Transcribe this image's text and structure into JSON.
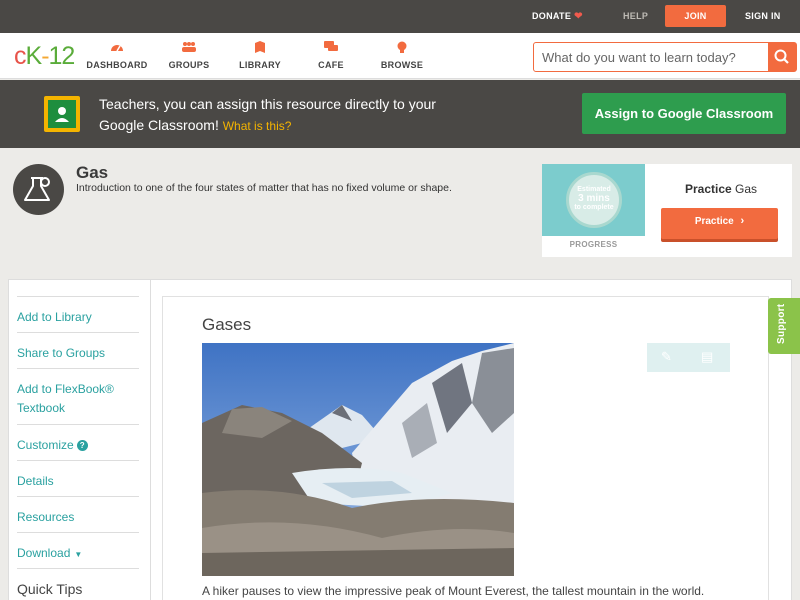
{
  "topbar": {
    "donate": "DONATE",
    "help": "HELP",
    "join": "JOIN",
    "signin": "SIGN IN"
  },
  "nav": {
    "logo": {
      "c": "c",
      "k": "K",
      "dash": "-",
      "n": "12"
    },
    "items": [
      {
        "label": "DASHBOARD",
        "icon": "dashboard-icon"
      },
      {
        "label": "GROUPS",
        "icon": "groups-icon"
      },
      {
        "label": "LIBRARY",
        "icon": "library-icon"
      },
      {
        "label": "CAFE",
        "icon": "cafe-icon"
      },
      {
        "label": "BROWSE",
        "icon": "browse-icon"
      }
    ],
    "search_placeholder": "What do you want to learn today?"
  },
  "banner": {
    "text": "Teachers, you can assign this resource directly to your Google Classroom!",
    "what_link": "What is this?",
    "assign_button": "Assign to Google Classroom"
  },
  "concept": {
    "title": "Gas",
    "description": "Introduction to one of the four states of matter that has no fixed volume or shape."
  },
  "practice": {
    "estimated": "Estimated",
    "mins": "3 mins",
    "to_complete": "to complete",
    "progress_label": "PROGRESS",
    "title_bold": "Practice",
    "title_rest": "Gas",
    "button": "Practice"
  },
  "sidebar": {
    "items": [
      "Add to Library",
      "Share to Groups",
      "Add to FlexBook® Textbook",
      "Customize",
      "Details",
      "Resources",
      "Download"
    ],
    "quick_tips": "Quick Tips"
  },
  "content": {
    "title": "Gases",
    "caption": "A hiker pauses to view the impressive peak of Mount Everest, the tallest mountain in the world."
  },
  "support": "Support",
  "colors": {
    "brand_orange": "#f26b3f",
    "dark_bar": "#4a4845",
    "google_green": "#2e9d4e",
    "link_teal": "#2aa1a0",
    "support_green": "#8bc34a"
  }
}
